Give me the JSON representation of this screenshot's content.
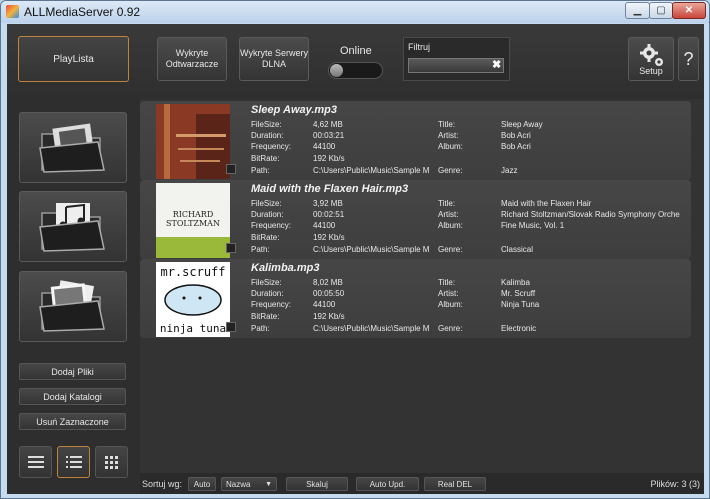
{
  "window": {
    "title": "ALLMediaServer 0.92"
  },
  "toolbar": {
    "playlist": "PlayLista",
    "detect_players": "Wykryte Odtwarzacze",
    "detect_servers": "Wykryte Serwery DLNA",
    "online_label": "Online",
    "filter_label": "Filtruj",
    "filter_value": "",
    "setup": "Setup",
    "help": "?"
  },
  "sidebar": {
    "add_files": "Dodaj Pliki",
    "add_folders": "Dodaj Katalogi",
    "remove_selected": "Usuń Zaznaczone"
  },
  "media_labels": {
    "filesize": "FileSize:",
    "duration": "Duration:",
    "frequency": "Frequency:",
    "bitrate": "BitRate:",
    "path": "Path:",
    "title": "Title:",
    "artist": "Artist:",
    "album": "Album:",
    "genre": "Genre:"
  },
  "media": [
    {
      "file": "Sleep Away.mp3",
      "filesize": "4,62 MB",
      "duration": "00:03:21",
      "frequency": "44100",
      "bitrate": "192 Kb/s",
      "path": "C:\\Users\\Public\\Music\\Sample M",
      "title": "Sleep Away",
      "artist": "Bob Acri",
      "album": "Bob Acri",
      "genre": "Jazz"
    },
    {
      "file": "Maid with the Flaxen Hair.mp3",
      "filesize": "3,92 MB",
      "duration": "00:02:51",
      "frequency": "44100",
      "bitrate": "192 Kb/s",
      "path": "C:\\Users\\Public\\Music\\Sample M",
      "title": "Maid with the Flaxen Hair",
      "artist": "Richard Stoltzman/Slovak Radio Symphony Orche",
      "album": "Fine Music, Vol. 1",
      "genre": "Classical",
      "art_line1": "RICHARD",
      "art_line2": "STOLTZMAN"
    },
    {
      "file": "Kalimba.mp3",
      "filesize": "8,02 MB",
      "duration": "00:05:50",
      "frequency": "44100",
      "bitrate": "192 Kb/s",
      "path": "C:\\Users\\Public\\Music\\Sample M",
      "title": "Kalimba",
      "artist": "Mr. Scruff",
      "album": "Ninja Tuna",
      "genre": "Electronic",
      "art_top": "mr.scruff",
      "art_bottom": "ninja tuna"
    }
  ],
  "statusbar": {
    "sort_label": "Sortuj wg:",
    "auto": "Auto",
    "sort_select": "Nazwa",
    "scale": "Skaluj",
    "auto_upd": "Auto Upd.",
    "real_del": "Real DEL",
    "files_count": "Plików: 3 (3)"
  },
  "icons": [
    "app-icon",
    "minimize-icon",
    "maximize-icon",
    "close-icon",
    "clear-icon",
    "gear-icon",
    "video-folder-icon",
    "music-folder-icon",
    "photo-folder-icon",
    "list-view-icon",
    "detail-view-icon",
    "grid-view-icon",
    "checkbox-icon"
  ],
  "colors": {
    "accent": "#c0833c",
    "background": "#2c2c2c",
    "item_bg": "#444444"
  }
}
